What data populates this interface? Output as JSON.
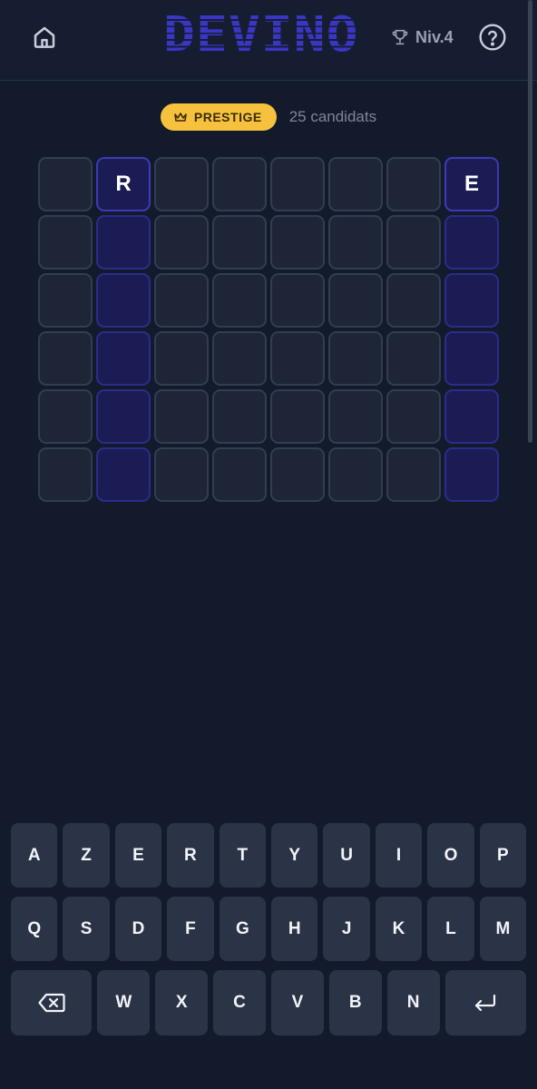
{
  "header": {
    "title": "DEVINO",
    "level": "Niv.4",
    "icons": {
      "home": "home-icon",
      "trophy": "trophy-icon",
      "help": "help-circle-icon"
    }
  },
  "status": {
    "badge": "PRESTIGE",
    "badge_icon": "crown-icon",
    "candidates": "25 candidats"
  },
  "board": {
    "columns": 8,
    "rows": [
      [
        "",
        "R",
        "",
        "",
        "",
        "",
        "",
        "E"
      ],
      [
        "",
        "",
        "",
        "",
        "",
        "",
        "",
        ""
      ],
      [
        "",
        "",
        "",
        "",
        "",
        "",
        "",
        ""
      ],
      [
        "",
        "",
        "",
        "",
        "",
        "",
        "",
        ""
      ],
      [
        "",
        "",
        "",
        "",
        "",
        "",
        "",
        ""
      ],
      [
        "",
        "",
        "",
        "",
        "",
        "",
        "",
        ""
      ]
    ],
    "highlighted_columns": [
      1,
      7
    ]
  },
  "keyboard": {
    "rows": [
      [
        "A",
        "Z",
        "E",
        "R",
        "T",
        "Y",
        "U",
        "I",
        "O",
        "P"
      ],
      [
        "Q",
        "S",
        "D",
        "F",
        "G",
        "H",
        "J",
        "K",
        "L",
        "M"
      ],
      [
        "backspace",
        "W",
        "X",
        "C",
        "V",
        "B",
        "N",
        "enter"
      ]
    ],
    "icons": {
      "backspace": "backspace-icon",
      "enter": "enter-icon"
    }
  },
  "colors": {
    "background": "#131a2c",
    "logo": "#3b35c4",
    "badge": "#f6c23e",
    "tile": "#1e2536",
    "hint_tile": "#1c1c55",
    "key": "#2b3346"
  }
}
